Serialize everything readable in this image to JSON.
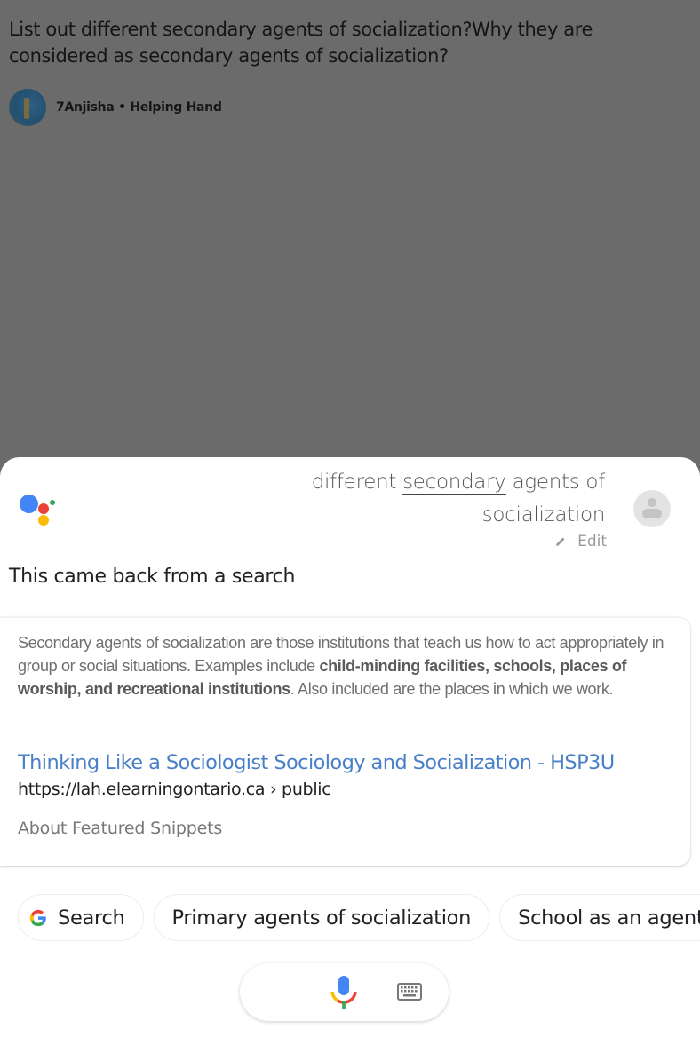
{
  "background_page": {
    "question": "List out different secondary agents of socialization?Why they are considered as secondary agents of socialization?",
    "author": {
      "name": "7Anjisha",
      "separator": "•",
      "rank": "Helping Hand"
    }
  },
  "assistant": {
    "query": {
      "before": "different ",
      "highlighted": "secondary",
      "after": " agents of socialization"
    },
    "edit_label": "Edit",
    "response_intro": "This came back from a search",
    "snippet": {
      "text_parts": [
        {
          "text": "Secondary agents of socialization are those institutions that teach us how to act appropriately in group or social situations. Examples include ",
          "bold": false
        },
        {
          "text": "child-minding facilities, schools, places of worship, and recreational institutions",
          "bold": true
        },
        {
          "text": ". Also included are the places in which we work.",
          "bold": false
        }
      ],
      "result_title": "Thinking Like a Sociologist Sociology and Socialization - HSP3U",
      "result_url": "https://lah.elearningontario.ca › public",
      "about_label": "About Featured Snippets"
    },
    "suggestion_chips": [
      {
        "label": "Search",
        "icon": "google-g-icon"
      },
      {
        "label": "Primary agents of socialization"
      },
      {
        "label": "School as an agent"
      }
    ],
    "input_bar": {
      "icons": [
        "microphone-icon",
        "keyboard-icon"
      ]
    }
  },
  "colors": {
    "scrim": "#6b6b6b",
    "link": "#4a80c8",
    "google_blue": "#4285f4",
    "google_red": "#ea4335",
    "google_yellow": "#fbbc05",
    "google_green": "#34a853"
  }
}
